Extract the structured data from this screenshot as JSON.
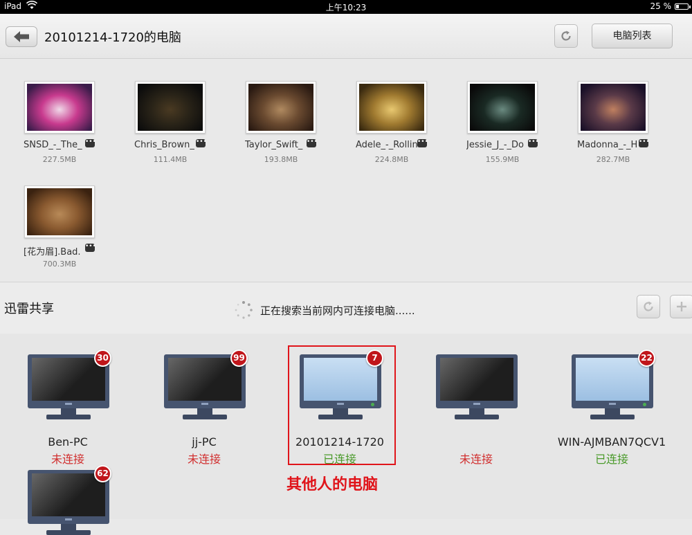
{
  "status_bar": {
    "device": "iPad",
    "time": "上午10:23",
    "battery": "25 %",
    "battery_level": 0.25
  },
  "header": {
    "title": "20101214-1720的电脑",
    "computer_list_label": "电脑列表"
  },
  "files": [
    {
      "name": "SNSD_-_The_",
      "size": "227.5MB",
      "thumb": [
        "#3b1c4a",
        "#c83a8e",
        "#f0d8e8"
      ]
    },
    {
      "name": "Chris_Brown_",
      "size": "111.4MB",
      "thumb": [
        "#0c0c0c",
        "#2a2418",
        "#4a3a22"
      ]
    },
    {
      "name": "Taylor_Swift_",
      "size": "193.8MB",
      "thumb": [
        "#2a1a12",
        "#6a4a30",
        "#b08a60"
      ]
    },
    {
      "name": "Adele_-_Rollin",
      "size": "224.8MB",
      "thumb": [
        "#3a2a10",
        "#a07a30",
        "#e8c870"
      ]
    },
    {
      "name": "Jessie_J_-_Do",
      "size": "155.9MB",
      "thumb": [
        "#0a0a0a",
        "#1a2a24",
        "#6a8a80"
      ]
    },
    {
      "name": "Madonna_-_H",
      "size": "282.7MB",
      "thumb": [
        "#1a1028",
        "#5a3a48",
        "#c08060"
      ]
    },
    {
      "name": "[花为眉].Bad.",
      "size": "700.3MB",
      "thumb": [
        "#3a2210",
        "#8a5a30",
        "#b88a58"
      ]
    }
  ],
  "share": {
    "title": "迅雷共享",
    "search_status": "正在搜索当前网内可连接电脑......"
  },
  "computers": [
    {
      "name": "Ben-PC",
      "status": "未连接",
      "connected": false,
      "count": "30"
    },
    {
      "name": "jj-PC",
      "status": "未连接",
      "connected": false,
      "count": "99"
    },
    {
      "name": "20101214-1720",
      "status": "已连接",
      "connected": true,
      "count": "7"
    },
    {
      "name": "",
      "status": "未连接",
      "connected": false,
      "count": ""
    },
    {
      "name": "WIN-AJMBAN7QCV1",
      "status": "已连接",
      "connected": true,
      "count": "22"
    },
    {
      "name": "",
      "status": "",
      "connected": false,
      "count": "62"
    }
  ],
  "annotation": {
    "label": "其他人的电脑",
    "color": "#e0141a"
  },
  "colors": {
    "not_connected": "#d12f2f",
    "connected": "#4a9a2a",
    "badge": "#c0161b"
  }
}
